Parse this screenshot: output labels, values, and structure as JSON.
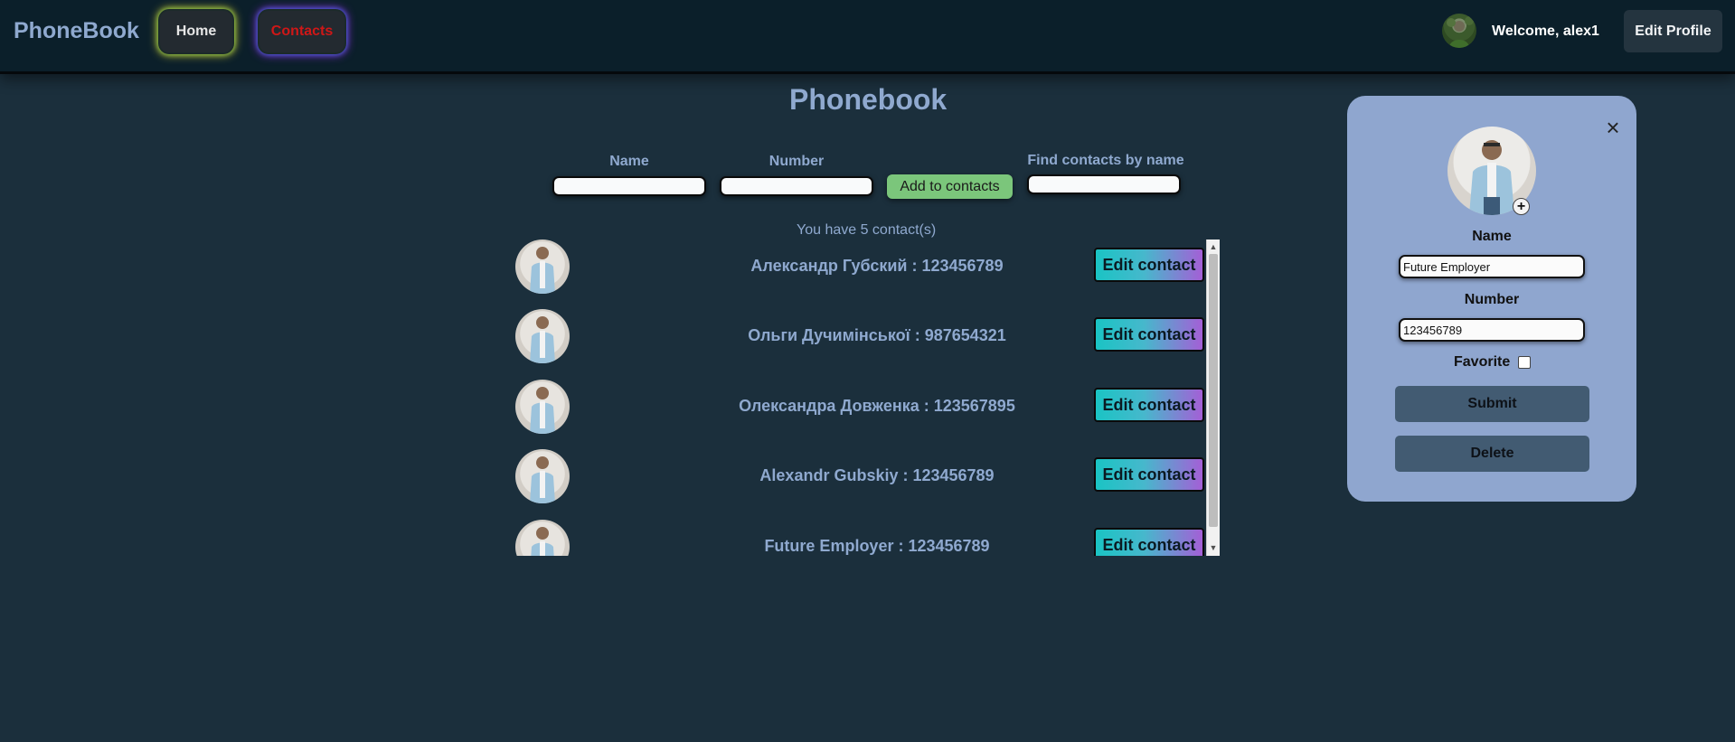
{
  "header": {
    "brand": "PhoneBook",
    "nav": [
      {
        "label": "Home"
      },
      {
        "label": "Contacts"
      }
    ],
    "welcome": "Welcome, alex1",
    "edit_profile": "Edit Profile"
  },
  "main": {
    "title": "Phonebook",
    "form": {
      "name_label": "Name",
      "number_label": "Number",
      "add_button": "Add to contacts",
      "name_value": "",
      "number_value": "",
      "find_label": "Find contacts by name",
      "find_value": ""
    },
    "count_text": "You have 5 contact(s)",
    "contacts": [
      {
        "text": "Александр Губский : 123456789",
        "edit": "Edit contact"
      },
      {
        "text": "Ольги Дучимінської : 987654321",
        "edit": "Edit contact"
      },
      {
        "text": "Олександра Довженка : 123567895",
        "edit": "Edit contact"
      },
      {
        "text": "Alexandr Gubskiy : 123456789",
        "edit": "Edit contact"
      },
      {
        "text": "Future Employer : 123456789",
        "edit": "Edit contact"
      }
    ]
  },
  "panel": {
    "close_glyph": "×",
    "add_photo_glyph": "+",
    "name_label": "Name",
    "name_value": "Future Employer",
    "number_label": "Number",
    "number_value": "123456789",
    "favorite_label": "Favorite",
    "favorite_checked": false,
    "submit": "Submit",
    "delete": "Delete"
  },
  "colors": {
    "background": "#1b2f3c",
    "header": "#0b1f2a",
    "accent_text": "#8fa9cf",
    "contacts_link": "#cf1717",
    "add_button": "#7bc67b",
    "panel": "#8fa6cf",
    "panel_button": "#425b72"
  },
  "icons": {
    "close": "close-icon",
    "add_photo": "plus-icon",
    "scroll_up": "scroll-up-arrow-icon",
    "scroll_down": "scroll-down-arrow-icon"
  }
}
